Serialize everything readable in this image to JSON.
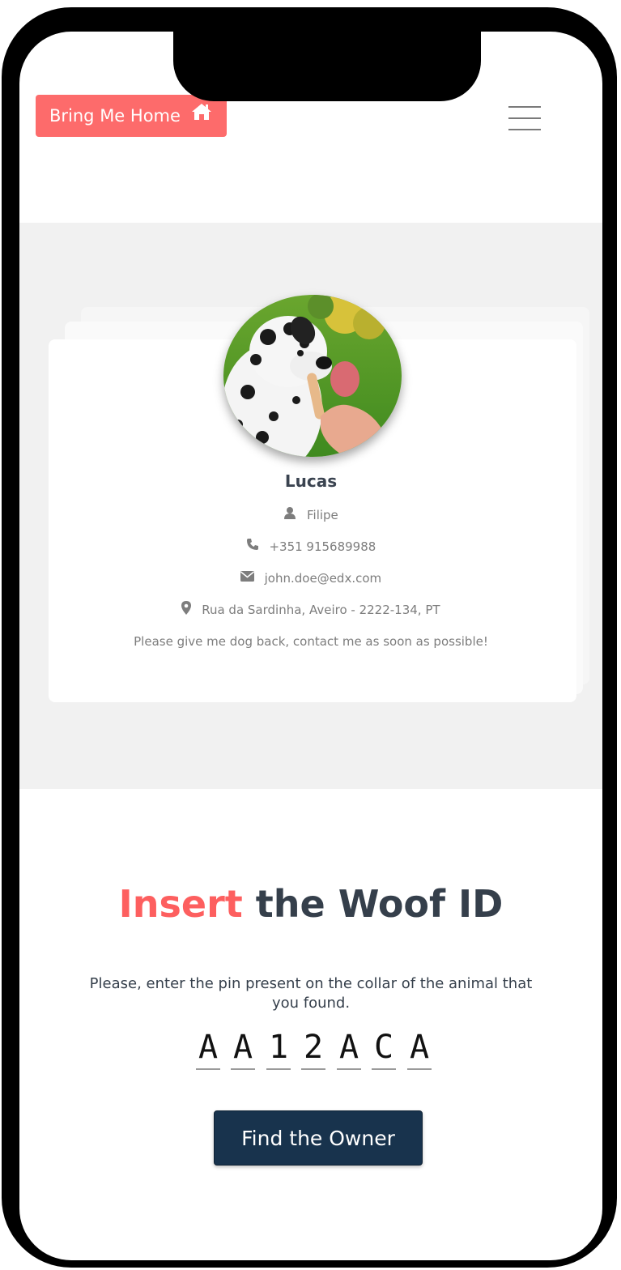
{
  "header": {
    "brand_label": "Bring Me Home",
    "brand_icon": "home-icon",
    "menu_icon": "hamburger-menu-icon"
  },
  "profile": {
    "pet_name": "Lucas",
    "owner_name": "Filipe",
    "phone": "+351 915689988",
    "email": "john.doe@edx.com",
    "address": "Rua da Sardinha, Aveiro - 2222-134, PT",
    "message": "Please give me dog back, contact me as soon as possible!",
    "photo_description": "dalmatian-dog-photo"
  },
  "woof": {
    "title_accent": "Insert",
    "title_rest": " the Woof ID",
    "instruction": "Please, enter the pin present on the collar of the animal that you found.",
    "pin": [
      "A",
      "A",
      "1",
      "2",
      "A",
      "C",
      "A"
    ],
    "button_label": "Find the Owner"
  },
  "colors": {
    "brand": "#fd6b6b",
    "accent": "#fd5f5f",
    "dark_text": "#353f4b",
    "button": "#18334d",
    "band": "#f1f1f1"
  }
}
